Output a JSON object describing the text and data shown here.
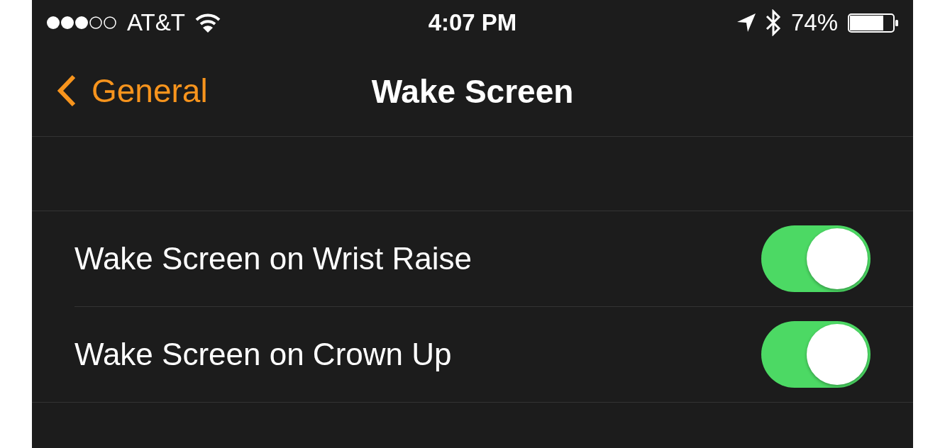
{
  "status_bar": {
    "carrier": "AT&T",
    "time": "4:07 PM",
    "battery": "74%"
  },
  "nav_bar": {
    "back": "General",
    "title": "Wake Screen"
  },
  "settings": [
    {
      "label": "Wake Screen on Wrist Raise",
      "on": true
    },
    {
      "label": "Wake Screen on Crown Up",
      "on": true
    }
  ]
}
